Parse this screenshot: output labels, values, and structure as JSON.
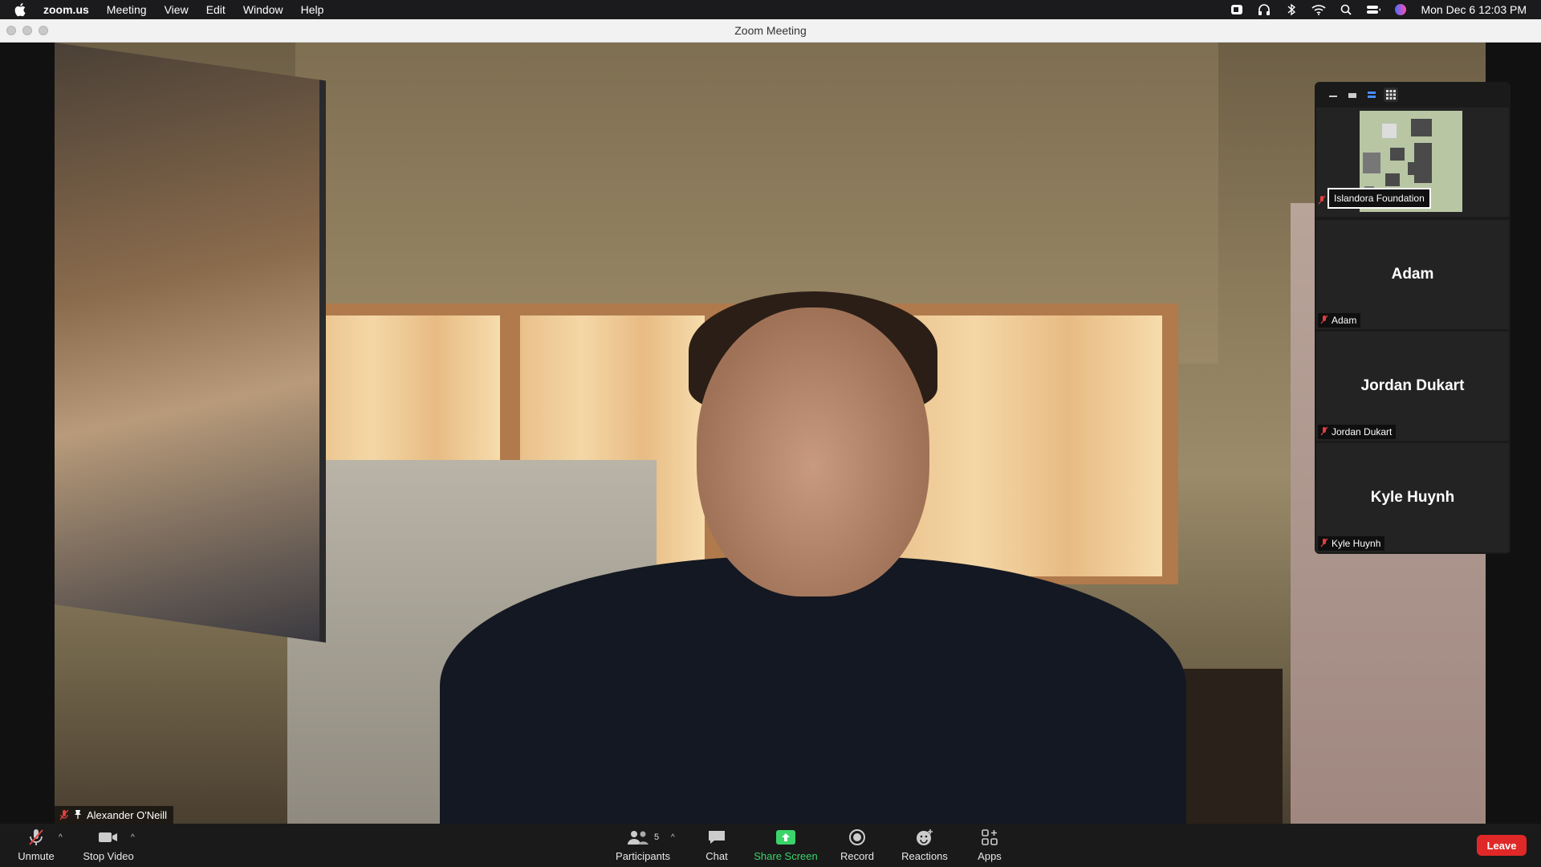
{
  "menubar": {
    "app_name": "zoom.us",
    "items": [
      "Meeting",
      "View",
      "Edit",
      "Window",
      "Help"
    ],
    "clock": "Mon Dec 6  12:03 PM"
  },
  "window": {
    "title": "Zoom Meeting"
  },
  "main_video": {
    "participant_name": "Alexander O'Neill"
  },
  "gallery": {
    "tiles": [
      {
        "display_name": "",
        "label": "Islandora Foundation"
      },
      {
        "display_name": "Adam",
        "label": "Adam"
      },
      {
        "display_name": "Jordan Dukart",
        "label": "Jordan Dukart"
      },
      {
        "display_name": "Kyle Huynh",
        "label": "Kyle Huynh"
      }
    ]
  },
  "toolbar": {
    "unmute": "Unmute",
    "stop_video": "Stop Video",
    "participants": "Participants",
    "participants_count": "5",
    "chat": "Chat",
    "share_screen": "Share Screen",
    "record": "Record",
    "reactions": "Reactions",
    "apps": "Apps",
    "leave": "Leave"
  },
  "colors": {
    "leave_button": "#e02828",
    "share_screen": "#3ad46a",
    "muted_red": "#e04040"
  }
}
